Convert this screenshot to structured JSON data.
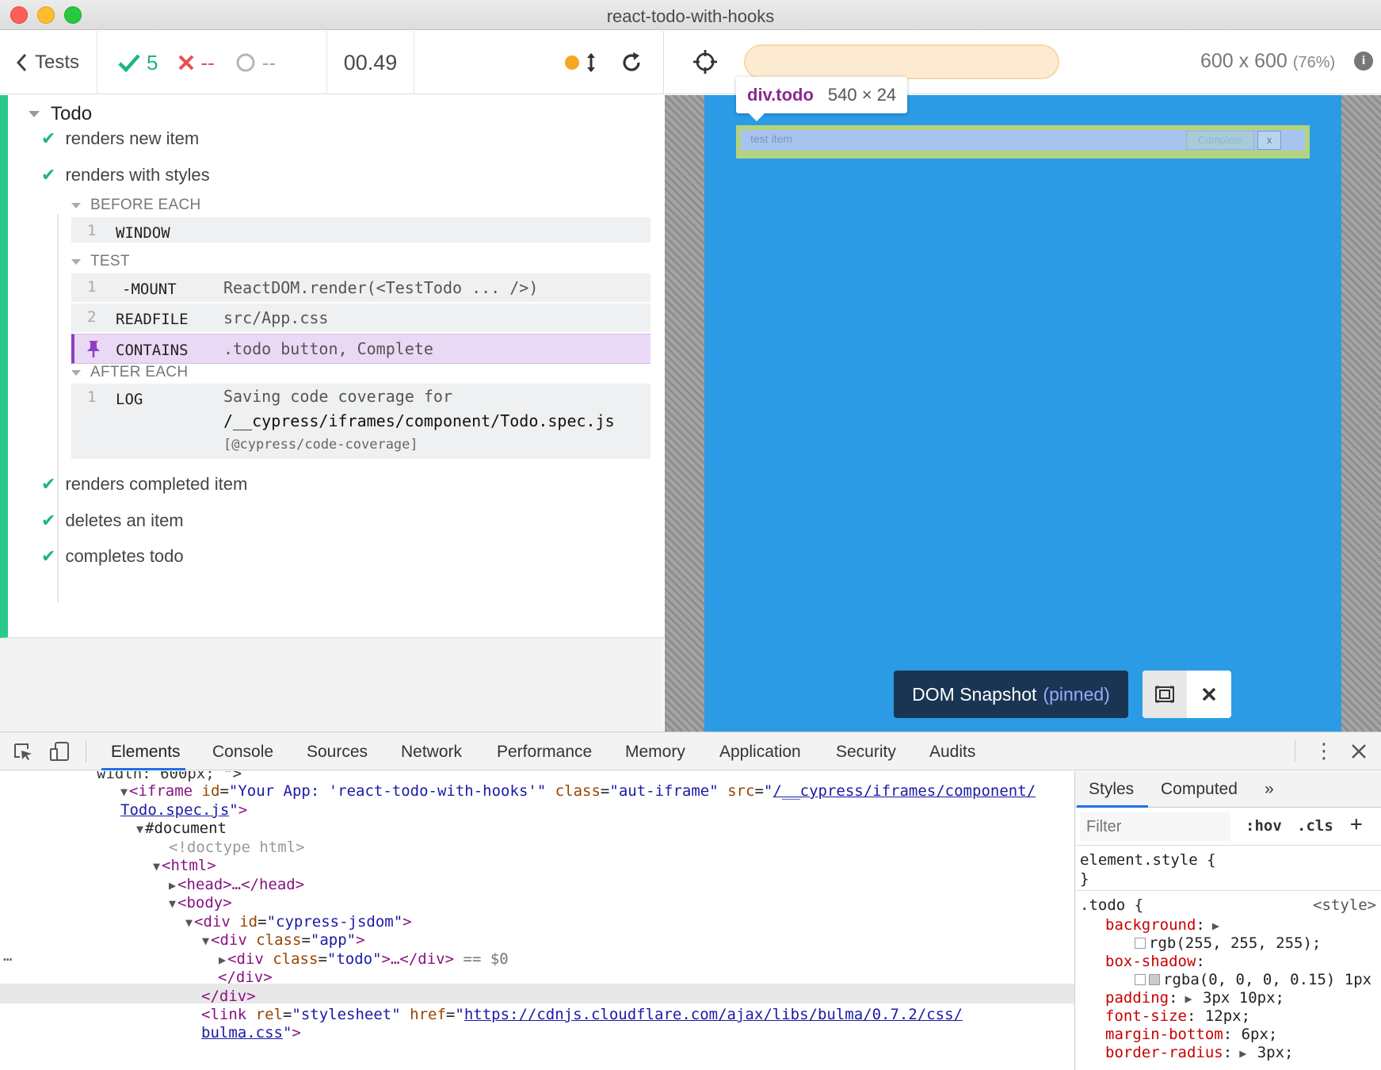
{
  "window": {
    "title": "react-todo-with-hooks"
  },
  "reporter_header": {
    "tests_label": "Tests",
    "passed": "5",
    "failed": "--",
    "pending": "--",
    "duration": "00.49"
  },
  "suite": {
    "title": "Todo",
    "tests": [
      {
        "title": "renders new item"
      },
      {
        "title": "renders with styles"
      },
      {
        "title": "renders completed item"
      },
      {
        "title": "deletes an item"
      },
      {
        "title": "completes todo"
      }
    ],
    "hooks": {
      "before_each": {
        "title": "BEFORE EACH",
        "commands": [
          {
            "num": "1",
            "name": "WINDOW",
            "message": ""
          }
        ]
      },
      "test": {
        "title": "TEST",
        "commands": [
          {
            "num": "1",
            "name": "-MOUNT",
            "message": "ReactDOM.render(<TestTodo ... />)"
          },
          {
            "num": "2",
            "name": "READFILE",
            "message": "src/App.css"
          },
          {
            "num": "",
            "name": "CONTAINS",
            "message": ".todo button, Complete"
          }
        ]
      },
      "after_each": {
        "title": "AFTER EACH",
        "commands": [
          {
            "num": "1",
            "name": "LOG",
            "message_lines": [
              "Saving code coverage for",
              "/__cypress/iframes/component/Todo.spec.js",
              "[@cypress/code-coverage]"
            ]
          }
        ]
      }
    }
  },
  "aut_header": {
    "url": "",
    "viewport": "600 x 600",
    "scale": "(76%)"
  },
  "aut": {
    "tooltip_tag": "div.todo",
    "tooltip_size": "540 × 24",
    "todo_text": "test item",
    "todo_complete": "Complete",
    "todo_x": "x",
    "snapshot_label": "DOM Snapshot",
    "snapshot_pinned": "(pinned)"
  },
  "devtools": {
    "tabs": [
      "Elements",
      "Console",
      "Sources",
      "Network",
      "Performance",
      "Memory",
      "Application",
      "Security",
      "Audits"
    ],
    "active_tab": "Elements",
    "tree": {
      "l0": "width: 600px; \">",
      "iframe_id": "\"Your App: 'react-todo-with-hooks'\"",
      "iframe_class": "\"aut-iframe\"",
      "iframe_src_a": "/__cypress/iframes/component/",
      "iframe_src_b": "Todo.spec.js",
      "document": "#document",
      "doctype": "<!doctype html>",
      "html_open": "<html>",
      "head": "<head>…</head>",
      "body_open": "<body>",
      "div_jsdom_id": "\"cypress-jsdom\"",
      "div_app_class": "\"app\"",
      "div_todo_class": "\"todo\"",
      "selected_suffix": "== $0",
      "div_close_1": "</div>",
      "div_close_2": "</div>",
      "link_rel": "\"stylesheet\"",
      "link_href_a": "https://cdnjs.cloudflare.com/ajax/libs/bulma/0.7.2/css/",
      "link_href_b": "bulma.css"
    },
    "styles": {
      "tabs": [
        "Styles",
        "Computed",
        "»"
      ],
      "filter_placeholder": "Filter",
      "hov": ":hov",
      "cls": ".cls",
      "add": "+",
      "element_style_open": "element.style {",
      "element_style_close": "}",
      "rule_selector": ".todo {",
      "rule_source": "<style>",
      "props": [
        {
          "name": "background",
          "value": "rgb(255, 255, 255);"
        },
        {
          "name": "box-shadow",
          "value": "rgba(0, 0, 0, 0.15) 1px"
        },
        {
          "name": "padding",
          "value": "3px 10px;"
        },
        {
          "name": "font-size",
          "value": "12px;"
        },
        {
          "name": "margin-bottom",
          "value": "6px;"
        },
        {
          "name": "border-radius",
          "value": "3px;"
        }
      ]
    }
  }
}
